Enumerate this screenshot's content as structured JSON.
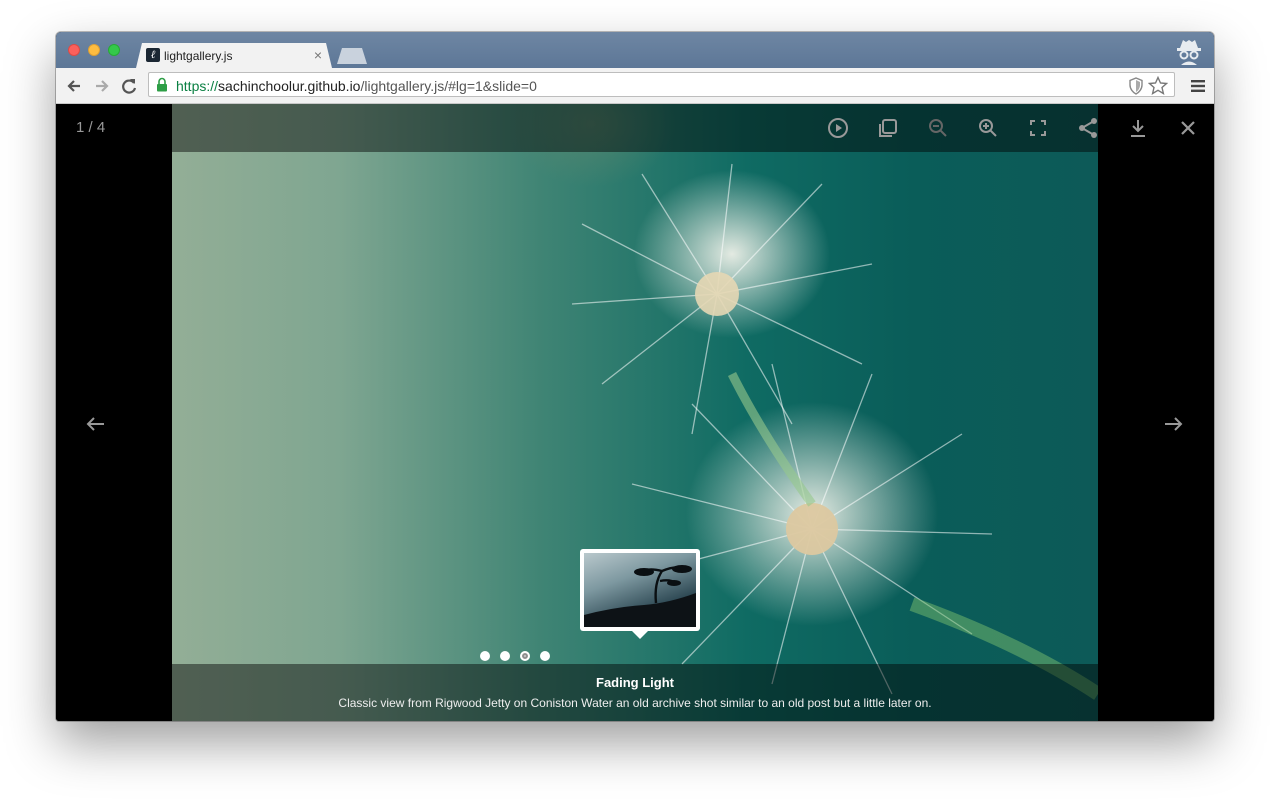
{
  "browser": {
    "tab_title": "lightgallery.js",
    "tab_close": "×",
    "url_scheme": "https://",
    "url_host": "sachinchoolur.github.io",
    "url_path": "/lightgallery.js/#lg=1&slide=0",
    "favicon_letter": "lg"
  },
  "gallery": {
    "counter": "1 / 4",
    "caption_title": "Fading Light",
    "caption_desc": "Classic view from Rigwood Jetty on Coniston Water an old archive shot similar to an old post but a little later on.",
    "slide_count": 4,
    "active_dot": 2,
    "toolbar_icons": [
      "play-icon",
      "thumbnails-icon",
      "zoom-out-icon",
      "zoom-in-icon",
      "fullscreen-icon",
      "share-icon",
      "download-icon",
      "close-icon"
    ]
  },
  "colors": {
    "accent_green": "#0b8043",
    "overlay": "rgba(0,0,0,0.45)"
  }
}
